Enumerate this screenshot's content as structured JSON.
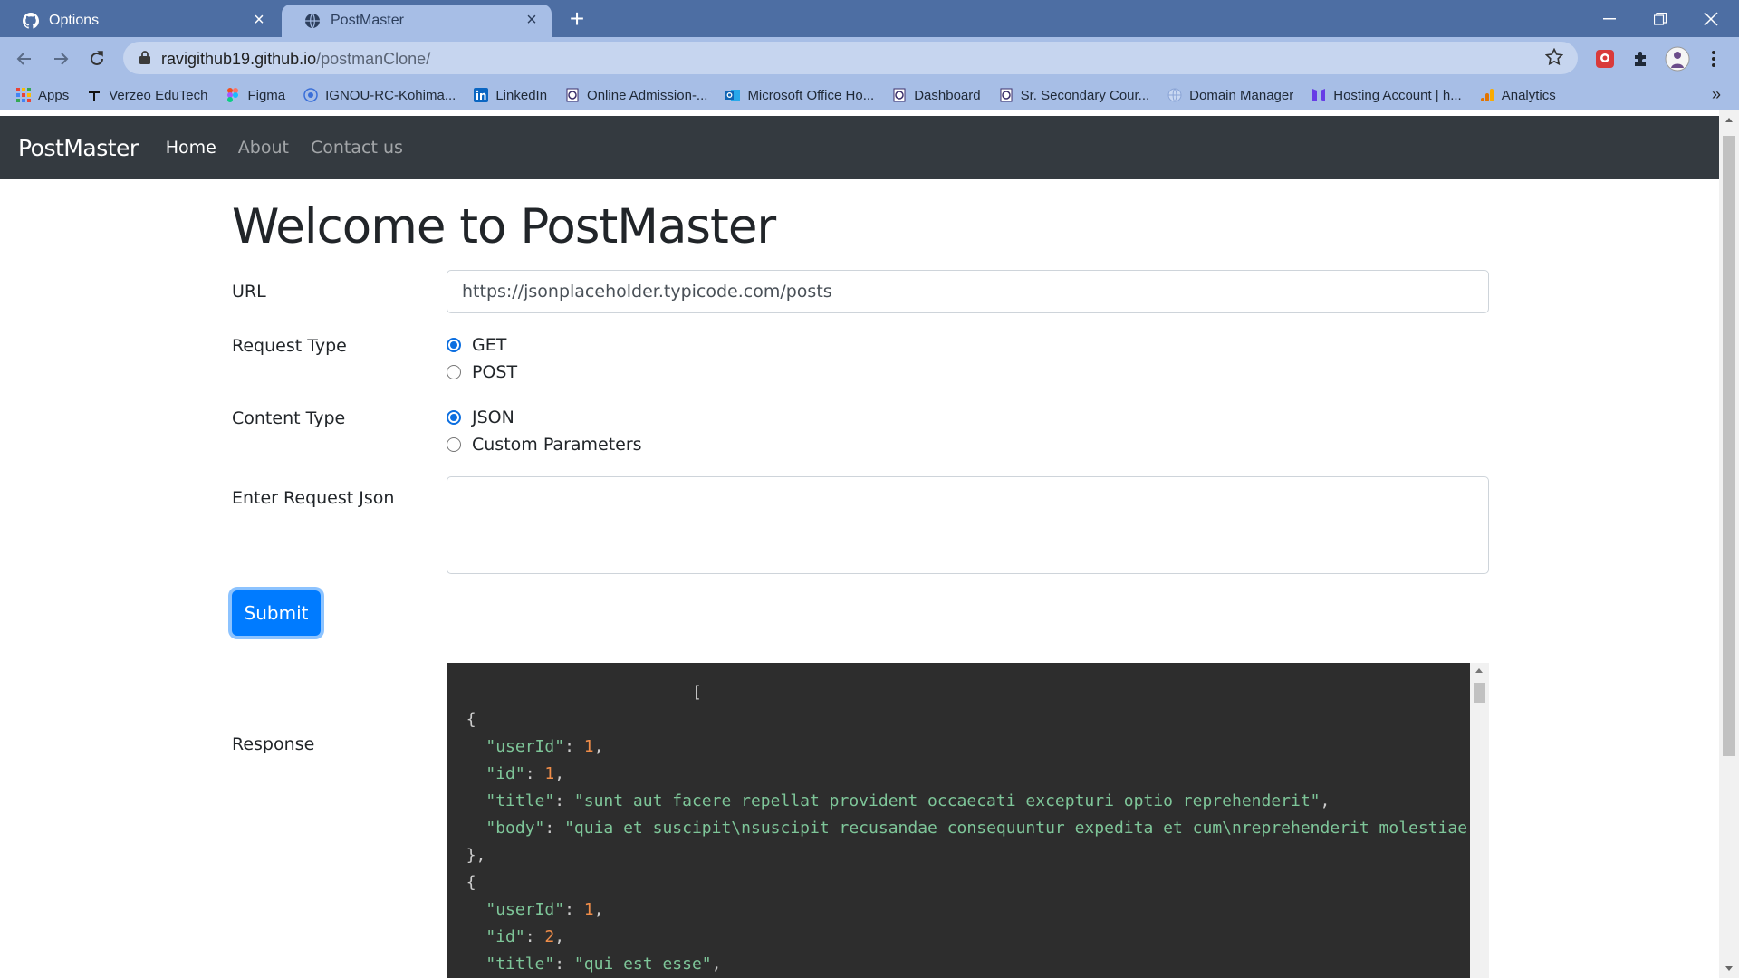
{
  "browser": {
    "tabs": [
      {
        "title": "Options",
        "icon": "github-icon",
        "active": false
      },
      {
        "title": "PostMaster",
        "icon": "globe-icon",
        "active": true
      }
    ],
    "address": {
      "host": "ravigithub19.github.io",
      "path": "/postmanClone/"
    },
    "bookmarks": [
      {
        "label": "Apps",
        "icon": "apps-grid-icon"
      },
      {
        "label": "Verzeo EduTech",
        "icon": "verzeo-icon"
      },
      {
        "label": "Figma",
        "icon": "figma-icon"
      },
      {
        "label": "IGNOU-RC-Kohima...",
        "icon": "ignou-icon"
      },
      {
        "label": "LinkedIn",
        "icon": "linkedin-icon"
      },
      {
        "label": "Online Admission-...",
        "icon": "nios-icon"
      },
      {
        "label": "Microsoft Office Ho...",
        "icon": "outlook-icon"
      },
      {
        "label": "Dashboard",
        "icon": "nios-icon"
      },
      {
        "label": "Sr. Secondary Cour...",
        "icon": "nios-icon"
      },
      {
        "label": "Domain Manager",
        "icon": "globe-icon"
      },
      {
        "label": "Hosting Account | h...",
        "icon": "hostinger-icon"
      },
      {
        "label": "Analytics",
        "icon": "analytics-icon"
      }
    ]
  },
  "navbar": {
    "brand": "PostMaster",
    "links": [
      {
        "label": "Home",
        "active": true
      },
      {
        "label": "About",
        "active": false
      },
      {
        "label": "Contact us",
        "active": false
      }
    ]
  },
  "form": {
    "title": "Welcome to PostMaster",
    "url_label": "URL",
    "url_value": "https://jsonplaceholder.typicode.com/posts",
    "request_type_label": "Request Type",
    "request_types": [
      {
        "label": "GET",
        "checked": true
      },
      {
        "label": "POST",
        "checked": false
      }
    ],
    "content_type_label": "Content Type",
    "content_types": [
      {
        "label": "JSON",
        "checked": true
      },
      {
        "label": "Custom Parameters",
        "checked": false
      }
    ],
    "request_json_label": "Enter Request Json",
    "request_json_value": "",
    "submit_label": "Submit",
    "response_label": "Response"
  },
  "response_lines": [
    {
      "indent": "                         ",
      "parts": [
        {
          "t": "p",
          "v": "["
        }
      ]
    },
    {
      "indent": "  ",
      "parts": [
        {
          "t": "p",
          "v": "{"
        }
      ]
    },
    {
      "indent": "    ",
      "parts": [
        {
          "t": "k",
          "v": "\"userId\""
        },
        {
          "t": "p",
          "v": ": "
        },
        {
          "t": "n",
          "v": "1"
        },
        {
          "t": "p",
          "v": ","
        }
      ]
    },
    {
      "indent": "    ",
      "parts": [
        {
          "t": "k",
          "v": "\"id\""
        },
        {
          "t": "p",
          "v": ": "
        },
        {
          "t": "n",
          "v": "1"
        },
        {
          "t": "p",
          "v": ","
        }
      ]
    },
    {
      "indent": "    ",
      "parts": [
        {
          "t": "k",
          "v": "\"title\""
        },
        {
          "t": "p",
          "v": ": "
        },
        {
          "t": "s",
          "v": "\"sunt aut facere repellat provident occaecati excepturi optio reprehenderit\""
        },
        {
          "t": "p",
          "v": ","
        }
      ]
    },
    {
      "indent": "    ",
      "parts": [
        {
          "t": "k",
          "v": "\"body\""
        },
        {
          "t": "p",
          "v": ": "
        },
        {
          "t": "s",
          "v": "\"quia et suscipit\\nsuscipit recusandae consequuntur expedita et cum\\nreprehenderit molestiae ut ut quas totam"
        }
      ]
    },
    {
      "indent": "  ",
      "parts": [
        {
          "t": "p",
          "v": "},"
        }
      ]
    },
    {
      "indent": "  ",
      "parts": [
        {
          "t": "p",
          "v": "{"
        }
      ]
    },
    {
      "indent": "    ",
      "parts": [
        {
          "t": "k",
          "v": "\"userId\""
        },
        {
          "t": "p",
          "v": ": "
        },
        {
          "t": "n",
          "v": "1"
        },
        {
          "t": "p",
          "v": ","
        }
      ]
    },
    {
      "indent": "    ",
      "parts": [
        {
          "t": "k",
          "v": "\"id\""
        },
        {
          "t": "p",
          "v": ": "
        },
        {
          "t": "n",
          "v": "2"
        },
        {
          "t": "p",
          "v": ","
        }
      ]
    },
    {
      "indent": "    ",
      "parts": [
        {
          "t": "k",
          "v": "\"title\""
        },
        {
          "t": "p",
          "v": ": "
        },
        {
          "t": "s",
          "v": "\"qui est esse\""
        },
        {
          "t": "p",
          "v": ","
        }
      ]
    }
  ],
  "colors": {
    "tabstrip": "#4d6ea3",
    "toolbar": "#a7bee6",
    "navbar": "#343a40",
    "primary": "#007bff",
    "code_bg": "#2d2d2d",
    "code_key": "#7ec699",
    "code_number": "#f08d49"
  }
}
